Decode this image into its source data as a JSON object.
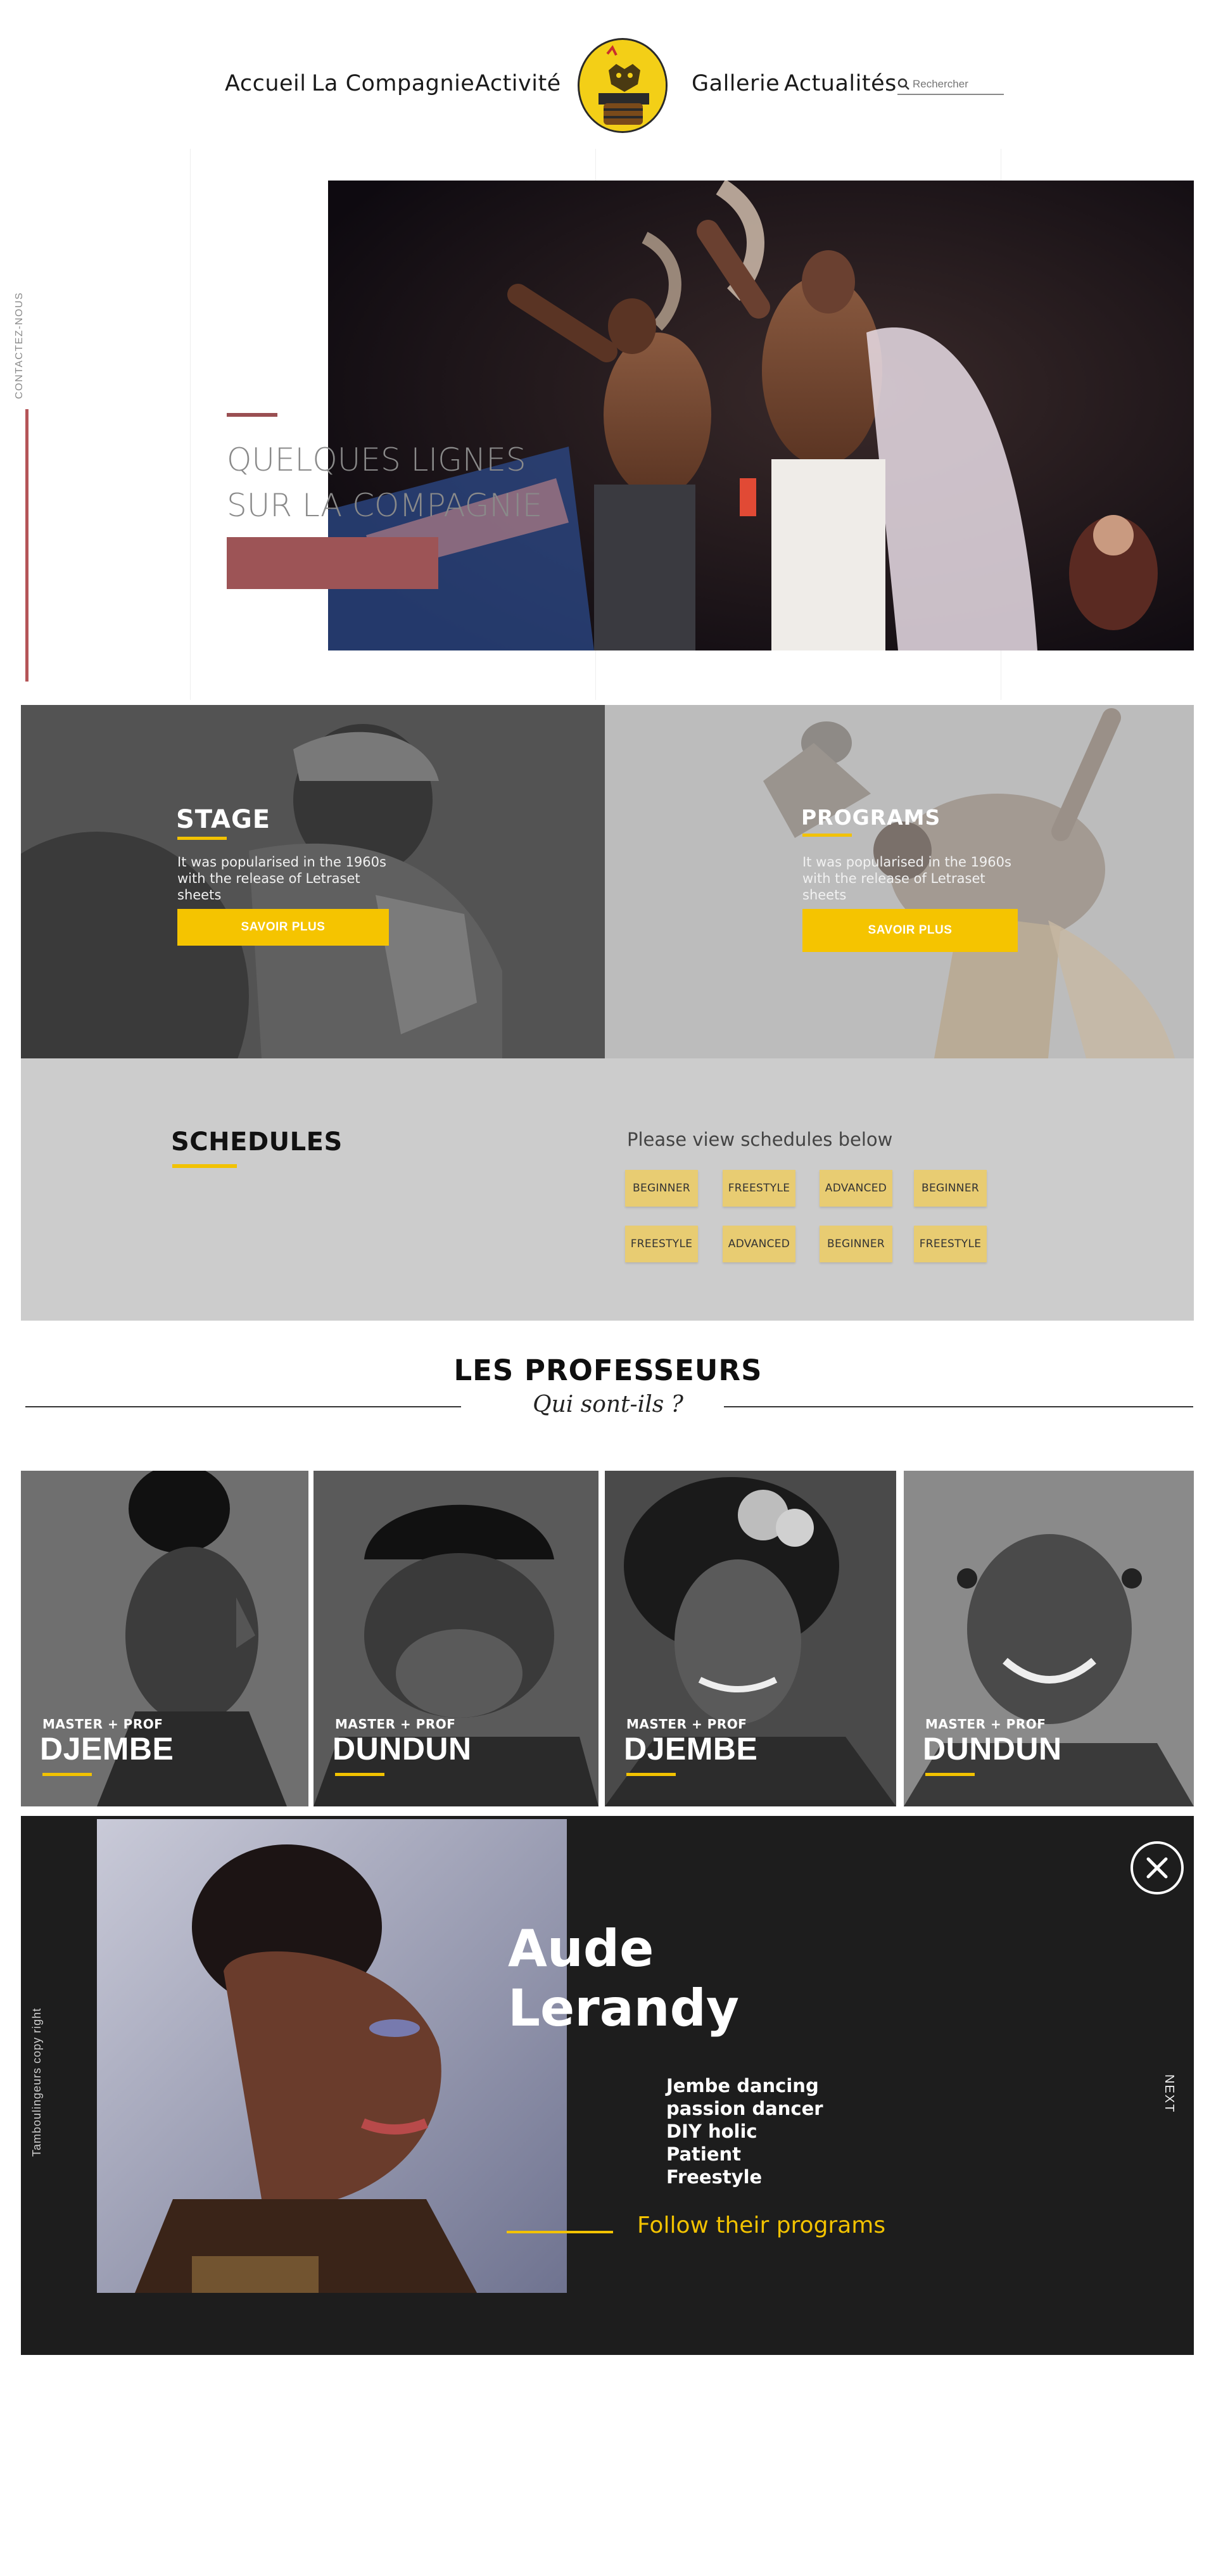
{
  "nav": {
    "links": [
      "Accueil",
      "La Compagnie",
      "Activité",
      "Gallerie",
      "Actualités"
    ],
    "search_placeholder": "Rechercher",
    "logo_icon": "drum-lion-logo"
  },
  "hero": {
    "side_label": "CONTACTEZ-NOUS",
    "title": "QUELQUES LIGNES\nSUR LA COMPAGNIE"
  },
  "cards": [
    {
      "title": "STAGE",
      "text": "It was popularised in the 1960s with the release of Letraset sheets",
      "button": "SAVOIR PLUS"
    },
    {
      "title": "PROGRAMS",
      "text": "It was popularised in the 1960s with the release of Letraset sheets",
      "button": "SAVOIR PLUS"
    }
  ],
  "schedules": {
    "title": "SCHEDULES",
    "subtitle": "Please view schedules below",
    "chips": [
      "BEGINNER",
      "FREESTYLE",
      "ADVANCED",
      "BEGINNER",
      "FREESTYLE",
      "ADVANCED",
      "BEGINNER",
      "FREESTYLE"
    ]
  },
  "professeurs": {
    "title": "LES PROFESSEURS",
    "subtitle": "Qui sont-ils ?",
    "tiles": [
      {
        "small": "MASTER + PROF",
        "big": "DJEMBE"
      },
      {
        "small": "MASTER + PROF",
        "big": "DUNDUN"
      },
      {
        "small": "MASTER + PROF",
        "big": "DJEMBE"
      },
      {
        "small": "MASTER + PROF",
        "big": "DUNDUN"
      }
    ]
  },
  "profile": {
    "side_label": "Tamboulingeurs copy right",
    "name": "Aude\nLerandy",
    "traits": [
      "Jembe dancing",
      "passion dancer",
      "DIY holic",
      "Patient",
      "Freestyle"
    ],
    "follow": "Follow their programs",
    "next": "NEXT"
  },
  "colors": {
    "accent_yellow": "#f2c200",
    "hero_button": "#9d5456",
    "side_bar": "#b55558",
    "schedule_bg": "#cccccc",
    "chip": "#e8cc72",
    "profile_bg": "#1d1d1d"
  }
}
